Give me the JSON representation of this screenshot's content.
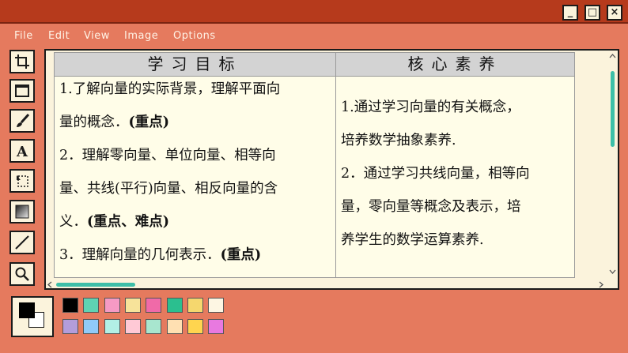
{
  "window": {
    "minimize": "_",
    "maximize": "□",
    "close": "×"
  },
  "menu": [
    "File",
    "Edit",
    "View",
    "Image",
    "Options"
  ],
  "tools": [
    "select-tool",
    "rectangle-tool",
    "brush-tool",
    "text-tool",
    "free-select-tool",
    "gradient-tool",
    "line-tool",
    "zoom-tool"
  ],
  "table": {
    "col1_header": "学习目标",
    "col2_header": "核心素养",
    "col1_lines": [
      {
        "text": "1.了解向量的实际背景，理解平面向",
        "bold": ""
      },
      {
        "text": "量的概念．",
        "bold": "(重点)"
      },
      {
        "text": "2．理解零向量、单位向量、相等向",
        "bold": ""
      },
      {
        "text": "量、共线(平行)向量、相反向量的含",
        "bold": ""
      },
      {
        "text": "义．",
        "bold": "(重点、难点)"
      },
      {
        "text": "3．理解向量的几何表示．",
        "bold": "(重点)"
      }
    ],
    "col2_lines": [
      "1.通过学习向量的有关概念，",
      "培养数学抽象素养.",
      "2．通过学习共线向量，相等向",
      "量，零向量等概念及表示，培",
      "养学生的数学运算素养."
    ]
  },
  "colors": {
    "primary": "#000000",
    "secondary": "#ffffff",
    "palette": [
      "#000000",
      "#5fd3b3",
      "#f59ac4",
      "#f7e39a",
      "#f06aa8",
      "#2bbf8f",
      "#f5d76e",
      "#fdf6e3",
      "#b39ddb",
      "#90caf9",
      "#b2f0e6",
      "#ffc9d6",
      "#a8e6cf",
      "#ffe0b2",
      "#ffd54f",
      "#e879e0"
    ]
  }
}
